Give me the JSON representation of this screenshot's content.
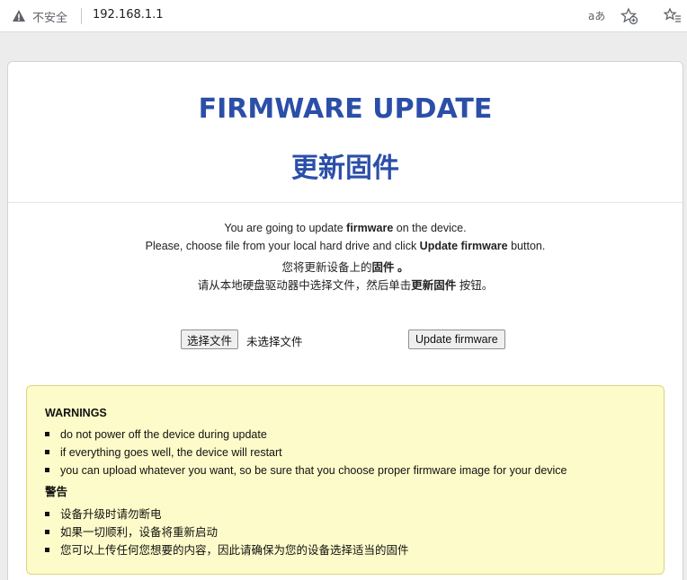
{
  "browser": {
    "security_label": "不安全",
    "url": "192.168.1.1",
    "read_aloud_label": "aあ"
  },
  "page": {
    "title_en": "FIRMWARE UPDATE",
    "title_zh": "更新固件",
    "intro": {
      "line1_pre": "You are going to update ",
      "line1_bold": "firmware",
      "line1_post": " on the device.",
      "line2_pre": "Please, choose file from your local hard drive and click ",
      "line2_bold": "Update firmware",
      "line2_post": " button.",
      "line3_pre": "您将更新设备上的",
      "line3_bold": "固件 。",
      "line4_pre": "请从本地硬盘驱动器中选择文件，然后单击",
      "line4_bold": "更新固件",
      "line4_post": " 按钮。"
    },
    "file_input": {
      "button_label": "选择文件",
      "status": "未选择文件"
    },
    "update_button_label": "Update firmware",
    "warnings": {
      "heading_en": "WARNINGS",
      "items_en": [
        "do not power off the device during update",
        "if everything goes well, the device will restart",
        "you can upload whatever you want, so be sure that you choose proper firmware image for your device"
      ],
      "heading_zh": "警告",
      "items_zh": [
        "设备升级时请勿断电",
        "如果一切顺利，设备将重新启动",
        "您可以上传任何您想要的内容，因此请确保为您的设备选择适当的固件"
      ]
    }
  },
  "colors": {
    "title": "#2b4fa8",
    "warning_bg": "#fdfbc9",
    "warning_border": "#e0d37a"
  }
}
